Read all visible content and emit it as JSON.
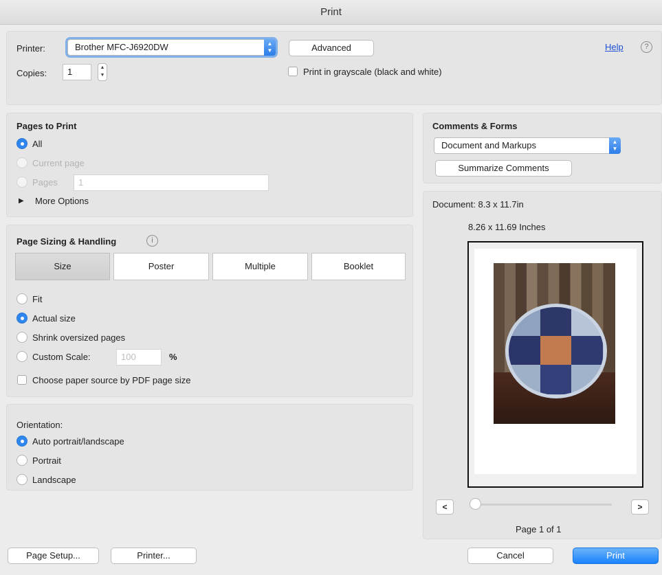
{
  "window": {
    "title": "Print"
  },
  "printer": {
    "label": "Printer:",
    "selected": "Brother MFC-J6920DW",
    "advanced_label": "Advanced",
    "help_label": "Help",
    "copies_label": "Copies:",
    "copies_value": "1",
    "grayscale_label": "Print in grayscale (black and white)",
    "grayscale_checked": false
  },
  "pages_to_print": {
    "title": "Pages to Print",
    "all_label": "All",
    "current_label": "Current page",
    "pages_label": "Pages",
    "pages_value": "1",
    "more_options_label": "More Options",
    "selected": "All"
  },
  "sizing": {
    "title": "Page Sizing & Handling",
    "tabs": [
      "Size",
      "Poster",
      "Multiple",
      "Booklet"
    ],
    "selected_tab": "Size",
    "fit_label": "Fit",
    "actual_label": "Actual size",
    "shrink_label": "Shrink oversized pages",
    "custom_label": "Custom Scale:",
    "custom_value": "100",
    "percent_label": "%",
    "paper_source_label": "Choose paper source by PDF page size",
    "selected": "Actual size"
  },
  "orientation": {
    "title": "Orientation:",
    "auto_label": "Auto portrait/landscape",
    "portrait_label": "Portrait",
    "landscape_label": "Landscape",
    "selected": "Auto portrait/landscape"
  },
  "comments": {
    "title": "Comments & Forms",
    "selected": "Document and Markups",
    "summarize_label": "Summarize Comments"
  },
  "preview": {
    "document_label": "Document: 8.3 x 11.7in",
    "size_label": "8.26 x 11.69 Inches",
    "prev_label": "<",
    "next_label": ">",
    "page_label": "Page 1 of 1"
  },
  "footer": {
    "page_setup_label": "Page Setup...",
    "printer_label": "Printer...",
    "cancel_label": "Cancel",
    "print_label": "Print"
  },
  "colors": {
    "accent": "#2f86ee",
    "link": "#1d4fd8"
  },
  "icons": [
    "help-circle-icon",
    "info-icon",
    "popup-arrows-icon",
    "stepper-icon",
    "disclosure-triangle-icon"
  ]
}
